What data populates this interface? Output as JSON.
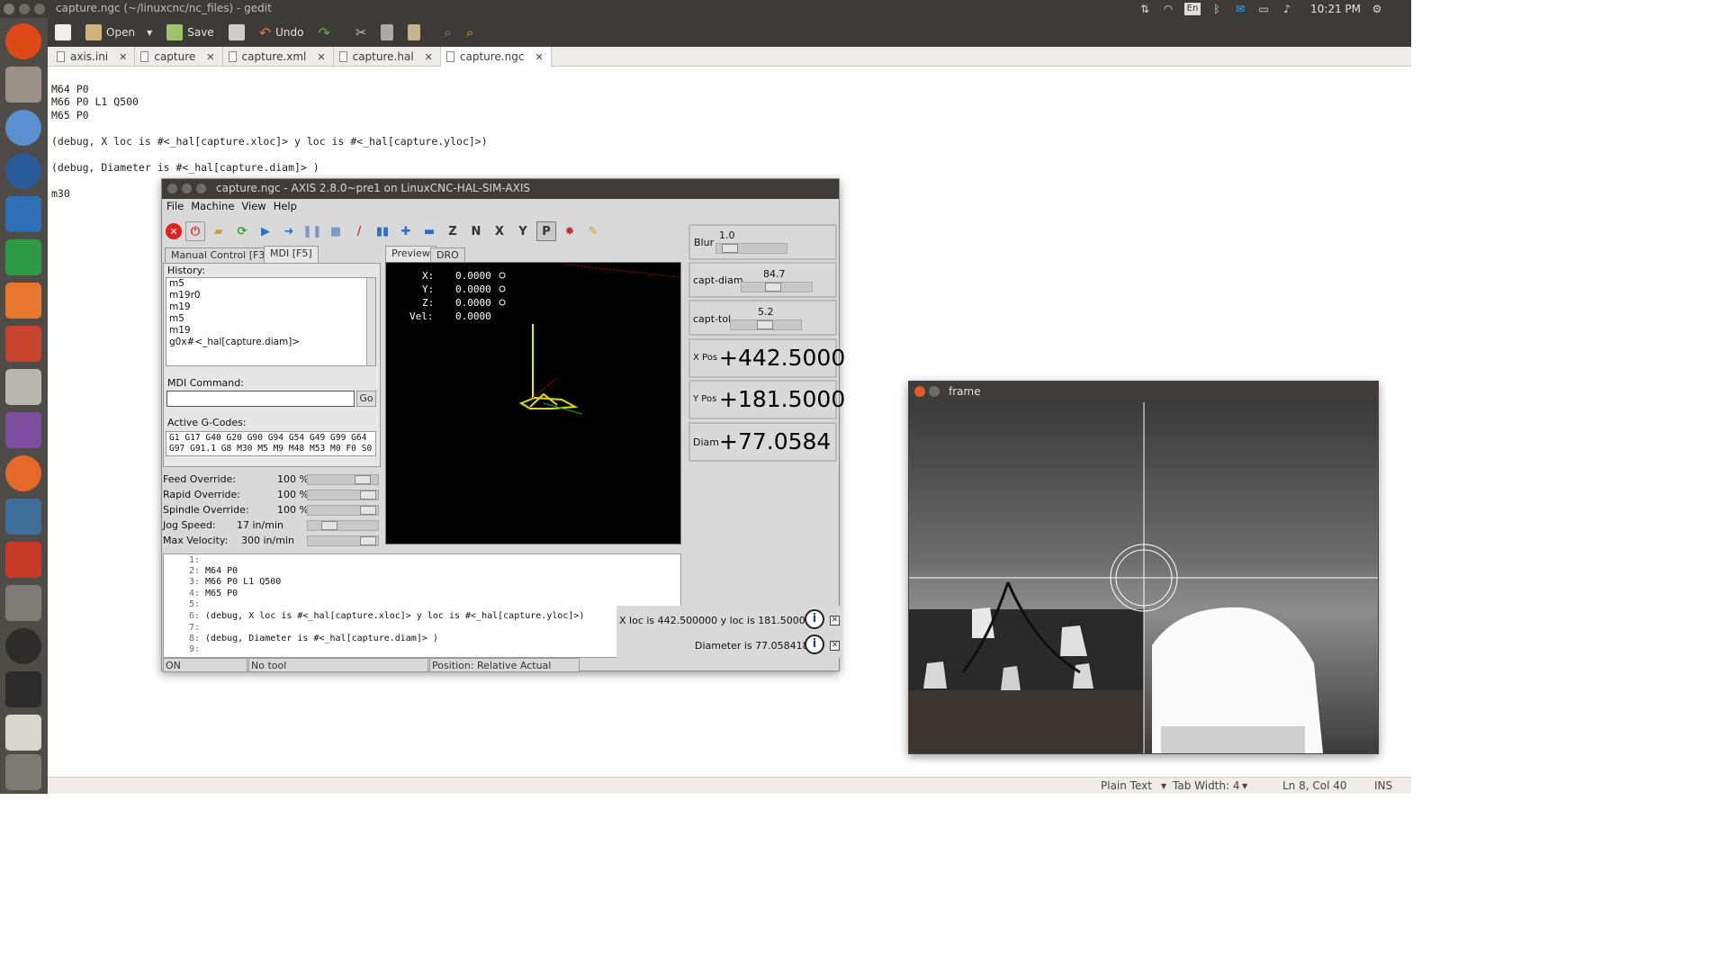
{
  "topbar": {
    "window_title": "capture.ngc (~/linuxcnc/nc_files) - gedit",
    "clock": "10:21 PM",
    "tray_icons": [
      "transfer-icon",
      "wifi-icon",
      "keyboard-layout-icon",
      "bluetooth-icon",
      "mail-icon",
      "battery-icon",
      "volume-icon",
      "gear-icon"
    ],
    "keyboard_label": "En"
  },
  "launcher": {
    "items": [
      "ubuntu-dash-icon",
      "files-icon",
      "chromium-icon",
      "thunderbird-icon",
      "writer-icon",
      "calc-icon",
      "software-center-icon",
      "settings-icon",
      "system-tools-icon",
      "pidgin-icon",
      "firefox-icon",
      "system-monitor-icon",
      "synaptic-icon",
      "tool-icon",
      "clock-icon",
      "terminal-icon",
      "gedit-icon",
      "trash-icon"
    ]
  },
  "toolbar": {
    "new_label": "",
    "open_label": "Open",
    "save_label": "Save",
    "undo_label": "Undo"
  },
  "tabs": [
    {
      "label": "axis.ini"
    },
    {
      "label": "capture"
    },
    {
      "label": "capture.xml"
    },
    {
      "label": "capture.hal"
    },
    {
      "label": "capture.ngc"
    }
  ],
  "editor": {
    "lines": [
      "",
      "M64 P0",
      "M66 P0 L1 Q500",
      "M65 P0",
      "",
      "(debug, X loc is #<_hal[capture.xloc]> y loc is #<_hal[capture.yloc]>)",
      "",
      "(debug, Diameter is #<_hal[capture.diam]> )",
      "",
      "m30"
    ]
  },
  "statusbar": {
    "language": "Plain Text",
    "tab_width": "Tab Width: 4",
    "position": "Ln 8, Col 40",
    "mode": "INS"
  },
  "axis": {
    "title": "capture.ngc - AXIS 2.8.0~pre1 on LinuxCNC-HAL-SIM-AXIS",
    "menu": [
      "File",
      "Machine",
      "View",
      "Help"
    ],
    "tabs": {
      "manual": "Manual Control [F3]",
      "mdi": "MDI [F5]",
      "preview": "Preview",
      "dro": "DRO"
    },
    "history_label": "History:",
    "history": [
      "m5",
      "m19r0",
      "m19",
      "m5",
      "m19",
      "g0x#<_hal[capture.diam]>"
    ],
    "mdi_label": "MDI Command:",
    "go_label": "Go",
    "gcodes_label": "Active G-Codes:",
    "gcodes_line1": "G1 G17 G40 G20 G90 G94 G54 G49 G99 G64",
    "gcodes_line2": "G97 G91.1 G8 M30 M5 M9 M48 M53 M0 F0 S0",
    "overrides": [
      {
        "label": "Feed Override:",
        "value": "100 %",
        "level": 0.9
      },
      {
        "label": "Rapid Override:",
        "value": "100 %",
        "level": 1.0
      },
      {
        "label": "Spindle Override:",
        "value": "100 %",
        "level": 1.0
      },
      {
        "label": "Jog Speed:",
        "value": "17 in/min",
        "level": 0.25
      },
      {
        "label": "Max Velocity:",
        "value": "300 in/min",
        "level": 1.0
      }
    ],
    "dro": {
      "x_label": "X:",
      "x_value": "0.0000",
      "y_label": "Y:",
      "y_value": "0.0000",
      "z_label": "Z:",
      "z_value": "0.0000",
      "vel_label": "Vel:",
      "vel_value": "0.0000"
    },
    "code_lines": [
      {
        "n": "1:",
        "t": ""
      },
      {
        "n": "2:",
        "t": "M64 P0"
      },
      {
        "n": "3:",
        "t": "M66 P0 L1 Q500"
      },
      {
        "n": "4:",
        "t": "M65 P0"
      },
      {
        "n": "5:",
        "t": ""
      },
      {
        "n": "6:",
        "t": "(debug, X loc is #<_hal[capture.xloc]> y loc is #<_hal[capture.yloc]>)"
      },
      {
        "n": "7:",
        "t": ""
      },
      {
        "n": "8:",
        "t": "(debug, Diameter is #<_hal[capture.diam]> )"
      },
      {
        "n": "9:",
        "t": ""
      }
    ],
    "status": {
      "state": "ON",
      "tool": "No tool",
      "position": "Position: Relative Actual"
    },
    "notifications": [
      {
        "text": "X loc is 442.500000 y loc is 181.500000"
      },
      {
        "text": "Diameter is 77.058418"
      }
    ],
    "pyvcp": {
      "blur_label": "Blur",
      "blur_value": "1.0",
      "blur_level": 0.1,
      "diam_label": "capt-diam",
      "diam_value": "84.7",
      "diam_level": 0.45,
      "tol_label": "capt-tol",
      "tol_value": "5.2",
      "tol_level": 0.5,
      "xpos_label": "X Pos",
      "xpos_value": "+442.5000",
      "ypos_label": "Y Pos",
      "ypos_value": "+181.5000",
      "diam_out_label": "Diam",
      "diam_out_value": "+77.0584"
    }
  },
  "frame": {
    "title": "frame"
  }
}
